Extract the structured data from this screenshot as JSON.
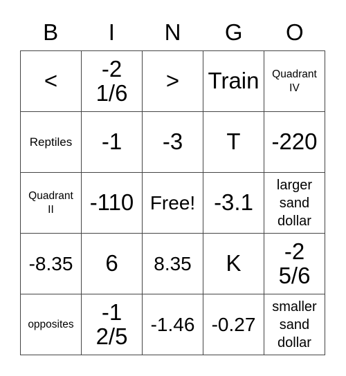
{
  "header": [
    "B",
    "I",
    "N",
    "G",
    "O"
  ],
  "cells": [
    [
      "<",
      "-2\n1/6",
      ">",
      "Train",
      "Quadrant\nIV"
    ],
    [
      "Reptiles",
      "-1",
      "-3",
      "T",
      "-220"
    ],
    [
      "Quadrant\nII",
      "-110",
      "Free!",
      "-3.1",
      "larger\nsand\ndollar"
    ],
    [
      "-8.35",
      "6",
      "8.35",
      "K",
      "-2\n5/6"
    ],
    [
      "opposites",
      "-1\n2/5",
      "-1.46",
      "-0.27",
      "smaller\nsand\ndollar"
    ]
  ]
}
